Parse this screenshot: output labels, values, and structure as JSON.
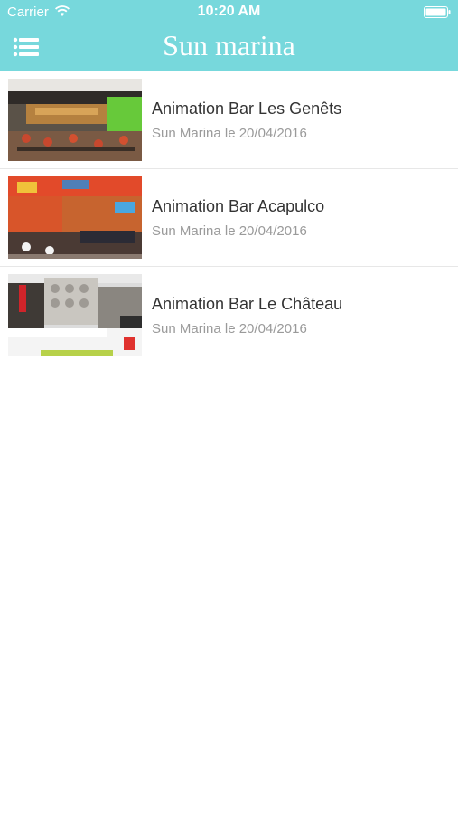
{
  "status": {
    "carrier": "Carrier",
    "time": "10:20 AM"
  },
  "header": {
    "title": "Sun marina",
    "accent": "#77d8dc"
  },
  "items": [
    {
      "title": "Animation Bar Les Genêts",
      "subtitle": "Sun Marina le 20/04/2016",
      "photo": "bar-les-genets-photo"
    },
    {
      "title": "Animation Bar Acapulco",
      "subtitle": "Sun Marina le 20/04/2016",
      "photo": "bar-acapulco-photo"
    },
    {
      "title": "Animation Bar Le Château",
      "subtitle": "Sun Marina le 20/04/2016",
      "photo": "bar-le-chateau-photo"
    }
  ]
}
